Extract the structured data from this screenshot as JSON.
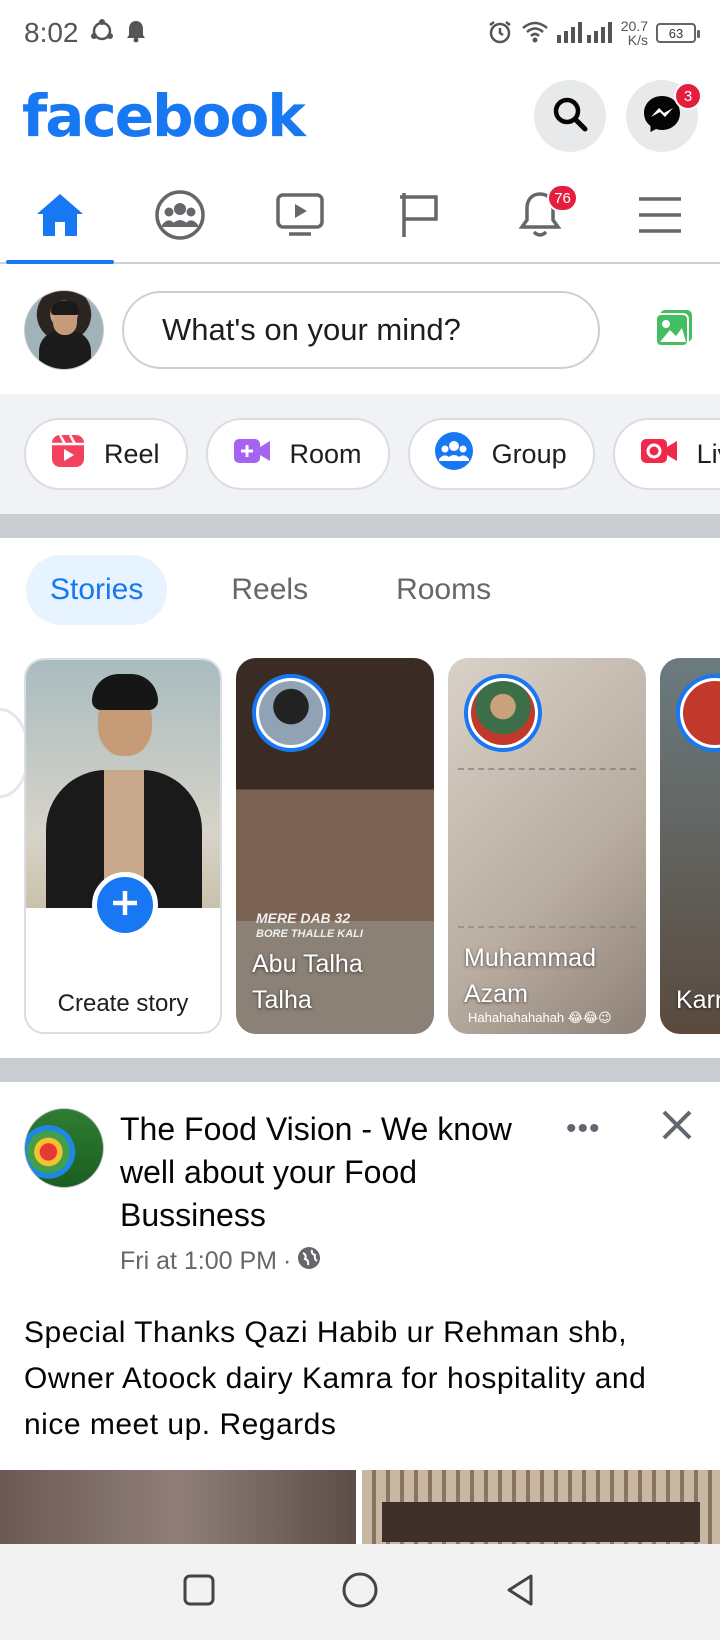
{
  "status_bar": {
    "time": "8:02",
    "net_speed_value": "20.7",
    "net_speed_unit": "K/s",
    "battery": "63"
  },
  "header": {
    "logo": "facebook",
    "messenger_badge": "3"
  },
  "tabs": {
    "notifications_badge": "76"
  },
  "composer": {
    "placeholder": "What's on your mind?"
  },
  "create_chips": [
    {
      "label": "Reel"
    },
    {
      "label": "Room"
    },
    {
      "label": "Group"
    },
    {
      "label": "Liv"
    }
  ],
  "story_tabs": [
    {
      "label": "Stories"
    },
    {
      "label": "Reels"
    },
    {
      "label": "Rooms"
    }
  ],
  "stories": {
    "create_label": "Create story",
    "items": [
      {
        "name_line1": "Abu Talha",
        "name_line2": "Talha",
        "overlay_line1": "MERE DAB 32",
        "overlay_line2": "BORE THALLE KALI"
      },
      {
        "name_line1": "Muhammad",
        "name_line2": "Azam",
        "caption": "Hahahahahahah 😂😂😉"
      },
      {
        "name_line1": "Karr"
      }
    ]
  },
  "post": {
    "page_name": "The Food Vision - We know well about your Food Bussiness",
    "time": "Fri at 1:00 PM",
    "separator": "·",
    "text": "Special Thanks Qazi Habib ur Rehman shb, Owner Atoock dairy Kamra for hospitality and nice meet up. Regards",
    "more": "•••"
  },
  "colors": {
    "brand": "#1877f2",
    "badge": "#e41e3f"
  }
}
